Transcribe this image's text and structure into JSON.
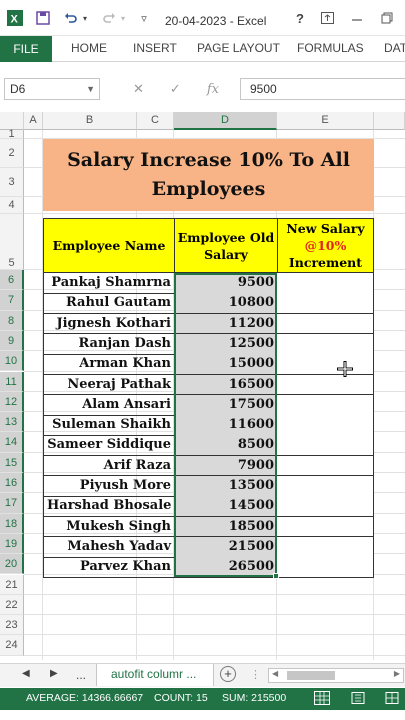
{
  "window": {
    "title": "20-04-2023 - Excel",
    "help_label": "?",
    "file_tab": "FILE",
    "ribbon_tabs": [
      "HOME",
      "INSERT",
      "PAGE LAYOUT",
      "FORMULAS",
      "DAT"
    ]
  },
  "formula_bar": {
    "name_box": "D6",
    "fx_label": "fx",
    "value": "9500"
  },
  "columns": [
    "A",
    "B",
    "C",
    "D",
    "E"
  ],
  "rows": [
    "1",
    "2",
    "3",
    "4",
    "5",
    "6",
    "7",
    "8",
    "9",
    "10",
    "11",
    "12",
    "13",
    "14",
    "15",
    "16",
    "17",
    "18",
    "19",
    "20",
    "21",
    "22",
    "23",
    "24"
  ],
  "selected_column": "D",
  "sheet": {
    "title": "Salary Increase 10% To All Employees",
    "title_line1": "Salary Increase 10% To All",
    "title_line2": "Employees",
    "header_name": "Employee Name",
    "header_old_salary_line1": "Employee Old",
    "header_old_salary_line2": "Salary",
    "header_new_line1": "New Salary",
    "header_new_line2": "@10%",
    "header_new_line3": "Increment",
    "employees": [
      {
        "name": "Pankaj Shamrna",
        "salary": "9500"
      },
      {
        "name": "Rahul Gautam",
        "salary": "10800"
      },
      {
        "name": "Jignesh Kothari",
        "salary": "11200"
      },
      {
        "name": "Ranjan Dash",
        "salary": "12500"
      },
      {
        "name": "Arman Khan",
        "salary": "15000"
      },
      {
        "name": "Neeraj Pathak",
        "salary": "16500"
      },
      {
        "name": "Alam Ansari",
        "salary": "17500"
      },
      {
        "name": "Suleman Shaikh",
        "salary": "11600"
      },
      {
        "name": "Sameer Siddique",
        "salary": "8500"
      },
      {
        "name": "Arif Raza",
        "salary": "7900"
      },
      {
        "name": "Piyush More",
        "salary": "13500"
      },
      {
        "name": "Harshad Bhosale",
        "salary": "14500"
      },
      {
        "name": "Mukesh Singh",
        "salary": "18500"
      },
      {
        "name": "Mahesh Yadav",
        "salary": "21500"
      },
      {
        "name": "Parvez Khan",
        "salary": "26500"
      }
    ]
  },
  "sheet_tabs": {
    "ellipsis": "...",
    "active": "autofit columr ...",
    "add_label": "+"
  },
  "status": {
    "average": "AVERAGE: 14366.66667",
    "count": "COUNT: 15",
    "sum": "SUM: 215500"
  },
  "colors": {
    "excel_green": "#217346",
    "banner_fill": "#f8b486",
    "header_fill": "#ffff00",
    "selected_fill": "#d9d9d9",
    "accent_red": "#e0261b"
  }
}
